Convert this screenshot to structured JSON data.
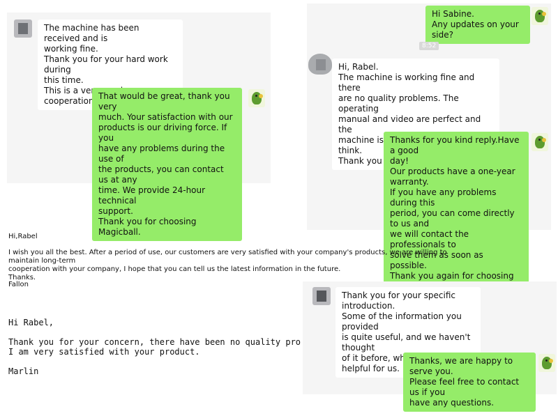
{
  "chat1": {
    "msg_in": "The machine has been received and is\nworking fine.\nThank you for your hard work during\nthis time.\nThis is a very good cooperation.",
    "msg_out": "That would be great, thank you very\nmuch. Your satisfaction with our\nproducts is our driving force. If you\nhave any problems during the use of\nthe products, you can contact us at any\ntime. We provide 24-hour technical\nsupport.\nThank you for choosing Magicball."
  },
  "chat2": {
    "msg_out1": "Hi Sabine.\nAny updates on your side?",
    "time": "8:52",
    "msg_in": "Hi, Rabel.\nThe machine is working fine and there\nare no quality problems. The operating\nmanual and video are perfect and the\nmachine is even better than we think.\nThank you for your service.",
    "msg_out2": "Thanks for you kind reply.Have a good\nday!\nOur products have a one-year warranty.\nIf you have any problems during this\nperiod, you can come directly to us and\nwe will contact the professionals to\nsolve them as soon as possible.\nThank you again for choosing\nMagicball."
  },
  "email1": {
    "greeting": "Hi,Rabel",
    "body_line1": "I wish you all the best. After a period of use, our customers are very satisfied with your company's products, we are willing to maintain long-term",
    "body_line2": "cooperation with your company, I hope that you can tell us the latest information in the future.",
    "thanks": "Thanks.",
    "signature": "Fallon"
  },
  "email2": {
    "greeting": "Hi Rabel,",
    "line1": "Thank you for your concern, there have been no quality problems so far",
    "line2": "I am very satisfied with your product.",
    "signature": "Marlin"
  },
  "chat3": {
    "msg_in": "Thank you for your specific\nintroduction.\nSome of the information you provided\nis quite useful, and we haven't thought\nof it before, which is very helpful for us.",
    "msg_out": "Thanks, we are happy to serve you.\nPlease feel free to contact us if you\nhave any questions."
  }
}
